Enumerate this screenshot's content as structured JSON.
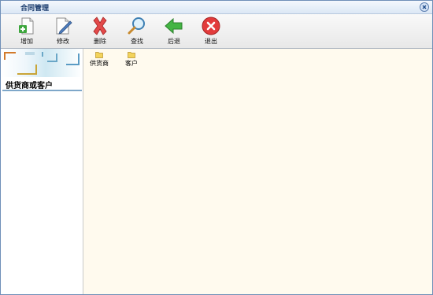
{
  "window": {
    "title": "合同管理"
  },
  "toolbar": {
    "buttons": [
      {
        "label": "增加",
        "icon": "add-document-icon"
      },
      {
        "label": "修改",
        "icon": "edit-document-icon"
      },
      {
        "label": "删除",
        "icon": "delete-x-icon"
      },
      {
        "label": "查找",
        "icon": "magnifier-icon"
      },
      {
        "label": "后退",
        "icon": "green-back-arrow-icon"
      },
      {
        "label": "退出",
        "icon": "red-exit-icon"
      }
    ]
  },
  "sidebar": {
    "title": "供货商或客户"
  },
  "content": {
    "folders": [
      {
        "label": "供货商",
        "icon": "folder-icon"
      },
      {
        "label": "客户",
        "icon": "folder-icon"
      }
    ]
  },
  "colors": {
    "content_bg": "#fffaee",
    "title_text": "#17396b",
    "folder": "#f3d35b"
  }
}
